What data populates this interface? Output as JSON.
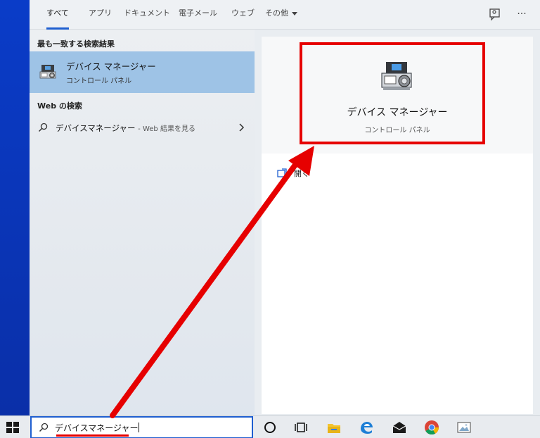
{
  "tabs": [
    {
      "label": "すべて",
      "active": true
    },
    {
      "label": "アプリ"
    },
    {
      "label": "ドキュメント"
    },
    {
      "label": "電子メール"
    },
    {
      "label": "ウェブ"
    },
    {
      "label": "その他"
    }
  ],
  "toolbar_icons": [
    "feedback-icon",
    "more-options-icon"
  ],
  "more_label": "···",
  "left": {
    "best_match_title": "最も一致する検索結果",
    "best_match": {
      "title": "デバイス マネージャー",
      "subtitle": "コントロール パネル",
      "icon": "device-manager-icon"
    },
    "web_title": "Web の検索",
    "web_result": {
      "query": "デバイスマネージャー",
      "suffix": "- Web 結果を見る"
    }
  },
  "detail": {
    "title": "デバイス マネージャー",
    "subtitle": "コントロール パネル",
    "open_label": "開く",
    "icon": "device-manager-icon"
  },
  "search": {
    "value": "デバイスマネージャー"
  },
  "taskbar_icons": [
    "start-icon",
    "search-icon",
    "cortana-icon",
    "task-view-icon",
    "file-explorer-icon",
    "edge-icon",
    "mail-icon",
    "chrome-icon",
    "photos-icon"
  ],
  "colors": {
    "accent": "#1f5fd0",
    "selected": "#9ec3e6",
    "highlight": "#e60000"
  }
}
